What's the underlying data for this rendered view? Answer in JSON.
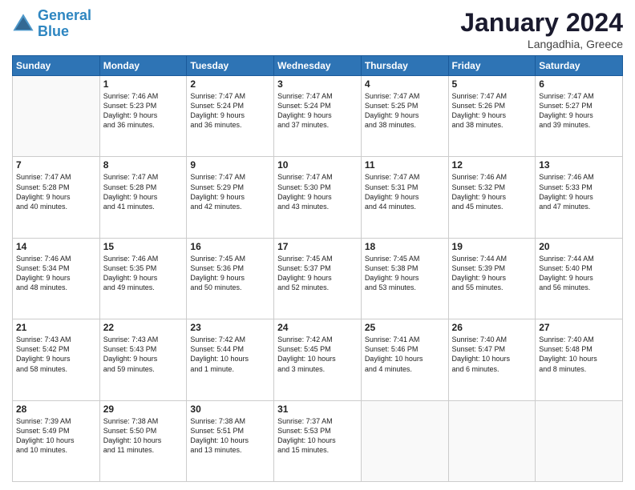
{
  "header": {
    "logo_line1": "General",
    "logo_line2": "Blue",
    "month": "January 2024",
    "location": "Langadhia, Greece"
  },
  "weekdays": [
    "Sunday",
    "Monday",
    "Tuesday",
    "Wednesday",
    "Thursday",
    "Friday",
    "Saturday"
  ],
  "weeks": [
    [
      {
        "day": "",
        "info": ""
      },
      {
        "day": "1",
        "info": "Sunrise: 7:46 AM\nSunset: 5:23 PM\nDaylight: 9 hours\nand 36 minutes."
      },
      {
        "day": "2",
        "info": "Sunrise: 7:47 AM\nSunset: 5:24 PM\nDaylight: 9 hours\nand 36 minutes."
      },
      {
        "day": "3",
        "info": "Sunrise: 7:47 AM\nSunset: 5:24 PM\nDaylight: 9 hours\nand 37 minutes."
      },
      {
        "day": "4",
        "info": "Sunrise: 7:47 AM\nSunset: 5:25 PM\nDaylight: 9 hours\nand 38 minutes."
      },
      {
        "day": "5",
        "info": "Sunrise: 7:47 AM\nSunset: 5:26 PM\nDaylight: 9 hours\nand 38 minutes."
      },
      {
        "day": "6",
        "info": "Sunrise: 7:47 AM\nSunset: 5:27 PM\nDaylight: 9 hours\nand 39 minutes."
      }
    ],
    [
      {
        "day": "7",
        "info": "Sunrise: 7:47 AM\nSunset: 5:28 PM\nDaylight: 9 hours\nand 40 minutes."
      },
      {
        "day": "8",
        "info": "Sunrise: 7:47 AM\nSunset: 5:28 PM\nDaylight: 9 hours\nand 41 minutes."
      },
      {
        "day": "9",
        "info": "Sunrise: 7:47 AM\nSunset: 5:29 PM\nDaylight: 9 hours\nand 42 minutes."
      },
      {
        "day": "10",
        "info": "Sunrise: 7:47 AM\nSunset: 5:30 PM\nDaylight: 9 hours\nand 43 minutes."
      },
      {
        "day": "11",
        "info": "Sunrise: 7:47 AM\nSunset: 5:31 PM\nDaylight: 9 hours\nand 44 minutes."
      },
      {
        "day": "12",
        "info": "Sunrise: 7:46 AM\nSunset: 5:32 PM\nDaylight: 9 hours\nand 45 minutes."
      },
      {
        "day": "13",
        "info": "Sunrise: 7:46 AM\nSunset: 5:33 PM\nDaylight: 9 hours\nand 47 minutes."
      }
    ],
    [
      {
        "day": "14",
        "info": "Sunrise: 7:46 AM\nSunset: 5:34 PM\nDaylight: 9 hours\nand 48 minutes."
      },
      {
        "day": "15",
        "info": "Sunrise: 7:46 AM\nSunset: 5:35 PM\nDaylight: 9 hours\nand 49 minutes."
      },
      {
        "day": "16",
        "info": "Sunrise: 7:45 AM\nSunset: 5:36 PM\nDaylight: 9 hours\nand 50 minutes."
      },
      {
        "day": "17",
        "info": "Sunrise: 7:45 AM\nSunset: 5:37 PM\nDaylight: 9 hours\nand 52 minutes."
      },
      {
        "day": "18",
        "info": "Sunrise: 7:45 AM\nSunset: 5:38 PM\nDaylight: 9 hours\nand 53 minutes."
      },
      {
        "day": "19",
        "info": "Sunrise: 7:44 AM\nSunset: 5:39 PM\nDaylight: 9 hours\nand 55 minutes."
      },
      {
        "day": "20",
        "info": "Sunrise: 7:44 AM\nSunset: 5:40 PM\nDaylight: 9 hours\nand 56 minutes."
      }
    ],
    [
      {
        "day": "21",
        "info": "Sunrise: 7:43 AM\nSunset: 5:42 PM\nDaylight: 9 hours\nand 58 minutes."
      },
      {
        "day": "22",
        "info": "Sunrise: 7:43 AM\nSunset: 5:43 PM\nDaylight: 9 hours\nand 59 minutes."
      },
      {
        "day": "23",
        "info": "Sunrise: 7:42 AM\nSunset: 5:44 PM\nDaylight: 10 hours\nand 1 minute."
      },
      {
        "day": "24",
        "info": "Sunrise: 7:42 AM\nSunset: 5:45 PM\nDaylight: 10 hours\nand 3 minutes."
      },
      {
        "day": "25",
        "info": "Sunrise: 7:41 AM\nSunset: 5:46 PM\nDaylight: 10 hours\nand 4 minutes."
      },
      {
        "day": "26",
        "info": "Sunrise: 7:40 AM\nSunset: 5:47 PM\nDaylight: 10 hours\nand 6 minutes."
      },
      {
        "day": "27",
        "info": "Sunrise: 7:40 AM\nSunset: 5:48 PM\nDaylight: 10 hours\nand 8 minutes."
      }
    ],
    [
      {
        "day": "28",
        "info": "Sunrise: 7:39 AM\nSunset: 5:49 PM\nDaylight: 10 hours\nand 10 minutes."
      },
      {
        "day": "29",
        "info": "Sunrise: 7:38 AM\nSunset: 5:50 PM\nDaylight: 10 hours\nand 11 minutes."
      },
      {
        "day": "30",
        "info": "Sunrise: 7:38 AM\nSunset: 5:51 PM\nDaylight: 10 hours\nand 13 minutes."
      },
      {
        "day": "31",
        "info": "Sunrise: 7:37 AM\nSunset: 5:53 PM\nDaylight: 10 hours\nand 15 minutes."
      },
      {
        "day": "",
        "info": ""
      },
      {
        "day": "",
        "info": ""
      },
      {
        "day": "",
        "info": ""
      }
    ]
  ]
}
